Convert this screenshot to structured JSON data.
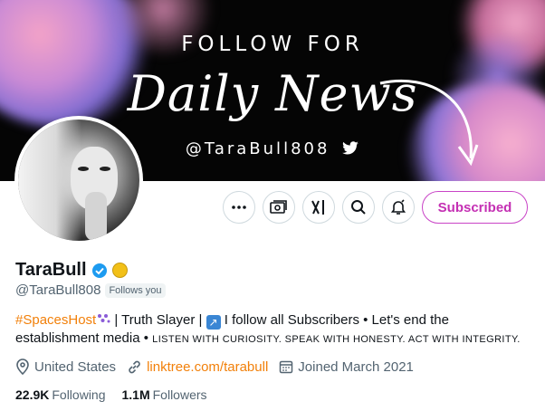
{
  "banner": {
    "headline": "FOLLOW FOR",
    "script_text": "Daily News",
    "handle": "@TaraBull808"
  },
  "actions": {
    "more_icon": "more-icon",
    "subscription_icon": "cash-icon",
    "grok_icon": "grok-icon",
    "search_icon": "search-icon",
    "notify_icon": "bell-icon",
    "subscribed_label": "Subscribed"
  },
  "profile": {
    "name": "TaraBull",
    "handle": "@TaraBull808",
    "follows_you": "Follows you",
    "bio": {
      "hashtag": "#SpacesHost",
      "part1": " | Truth Slayer | ",
      "part2": " I follow all Subscribers • Let's end the establishment media • ",
      "caps": "LISTEN WITH CURIOSITY. SPEAK WITH HONESTY. ACT WITH INTEGRITY."
    },
    "location": "United States",
    "link": "linktree.com/tarabull",
    "joined": "Joined March 2021",
    "following_count": "22.9K",
    "following_label": "Following",
    "followers_count": "1.1M",
    "followers_label": "Followers"
  },
  "colors": {
    "accent": "#c42fb3",
    "link": "#f2800a",
    "verified": "#1d9bf0"
  }
}
